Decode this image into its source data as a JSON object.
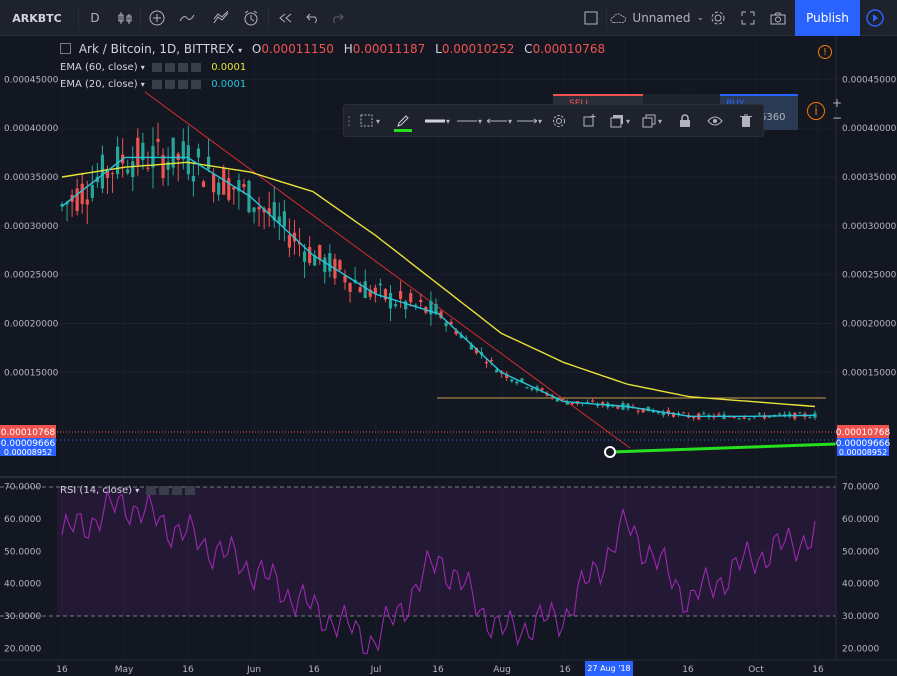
{
  "toolbar": {
    "symbol": "ARKBTC",
    "interval": "D",
    "layout_name": "Unnamed",
    "publish_label": "Publish"
  },
  "legend": {
    "title": "Ark / Bitcoin, 1D, BITTREX",
    "o_label": "O",
    "o_value": "0.00011150",
    "h_label": "H",
    "h_value": "0.00011187",
    "l_label": "L",
    "l_value": "0.00010252",
    "c_label": "C",
    "c_value": "0.00010768"
  },
  "indicators": {
    "ema60_label": "EMA (60, close)",
    "ema60_value": "0.0001",
    "ema20_label": "EMA (20, close)",
    "ema20_value": "0.0001",
    "rsi_label": "RSI (14, close)"
  },
  "trade": {
    "sell_label": "SELL",
    "buy_label": "BUY",
    "buy_value": "6360"
  },
  "price_axis": [
    "0.00045000",
    "0.00040000",
    "0.00035000",
    "0.00030000",
    "0.00025000",
    "0.00020000",
    "0.00015000"
  ],
  "price_marks": {
    "last": "0.00010768",
    "ema": "0.00009666",
    "ema_hidden": "0.00008952"
  },
  "rsi_axis": [
    "70.0000",
    "60.0000",
    "50.0000",
    "40.0000",
    "30.0000",
    "20.0000"
  ],
  "time_axis": [
    "16",
    "May",
    "16",
    "Jun",
    "16",
    "Jul",
    "16",
    "Aug",
    "16",
    "p",
    "16",
    "Oct",
    "16"
  ],
  "time_cursor": "27 Aug '18",
  "colors": {
    "background": "#131722",
    "up": "#26a69a",
    "down": "#ef5350",
    "ema60": "#e8e337",
    "ema20": "#26c6da",
    "rsi": "#9c27b0",
    "trendline": "#d32f2f",
    "support": "#26e020",
    "horizontal": "#c8a04a",
    "accent": "#2962ff"
  },
  "chart_data": {
    "type": "candlestick",
    "price_range": [
      5e-05,
      0.00048
    ],
    "rsi_range": [
      18,
      72
    ],
    "rsi_bands": [
      70,
      30
    ],
    "x": [
      "Apr 16",
      "May 1",
      "May 16",
      "Jun 1",
      "Jun 16",
      "Jul 1",
      "Jul 16",
      "Aug 1",
      "Aug 16",
      "Sep 1",
      "Sep 16",
      "Oct 1",
      "Oct 16"
    ],
    "series": [
      {
        "name": "EMA (60, close)",
        "values": [
          0.00035,
          0.00036,
          0.000365,
          0.000355,
          0.000335,
          0.00029,
          0.00024,
          0.00019,
          0.00016,
          0.000138,
          0.000125,
          0.00012,
          0.000115
        ]
      },
      {
        "name": "EMA (20, close)",
        "values": [
          0.00032,
          0.00037,
          0.00037,
          0.00033,
          0.00027,
          0.00023,
          0.00021,
          0.00015,
          0.00012,
          0.000115,
          0.000105,
          0.000105,
          0.000106
        ]
      },
      {
        "name": "RSI (14, close)",
        "values": [
          55,
          65,
          55,
          45,
          32,
          22,
          48,
          25,
          30,
          58,
          35,
          48,
          55
        ]
      }
    ]
  }
}
